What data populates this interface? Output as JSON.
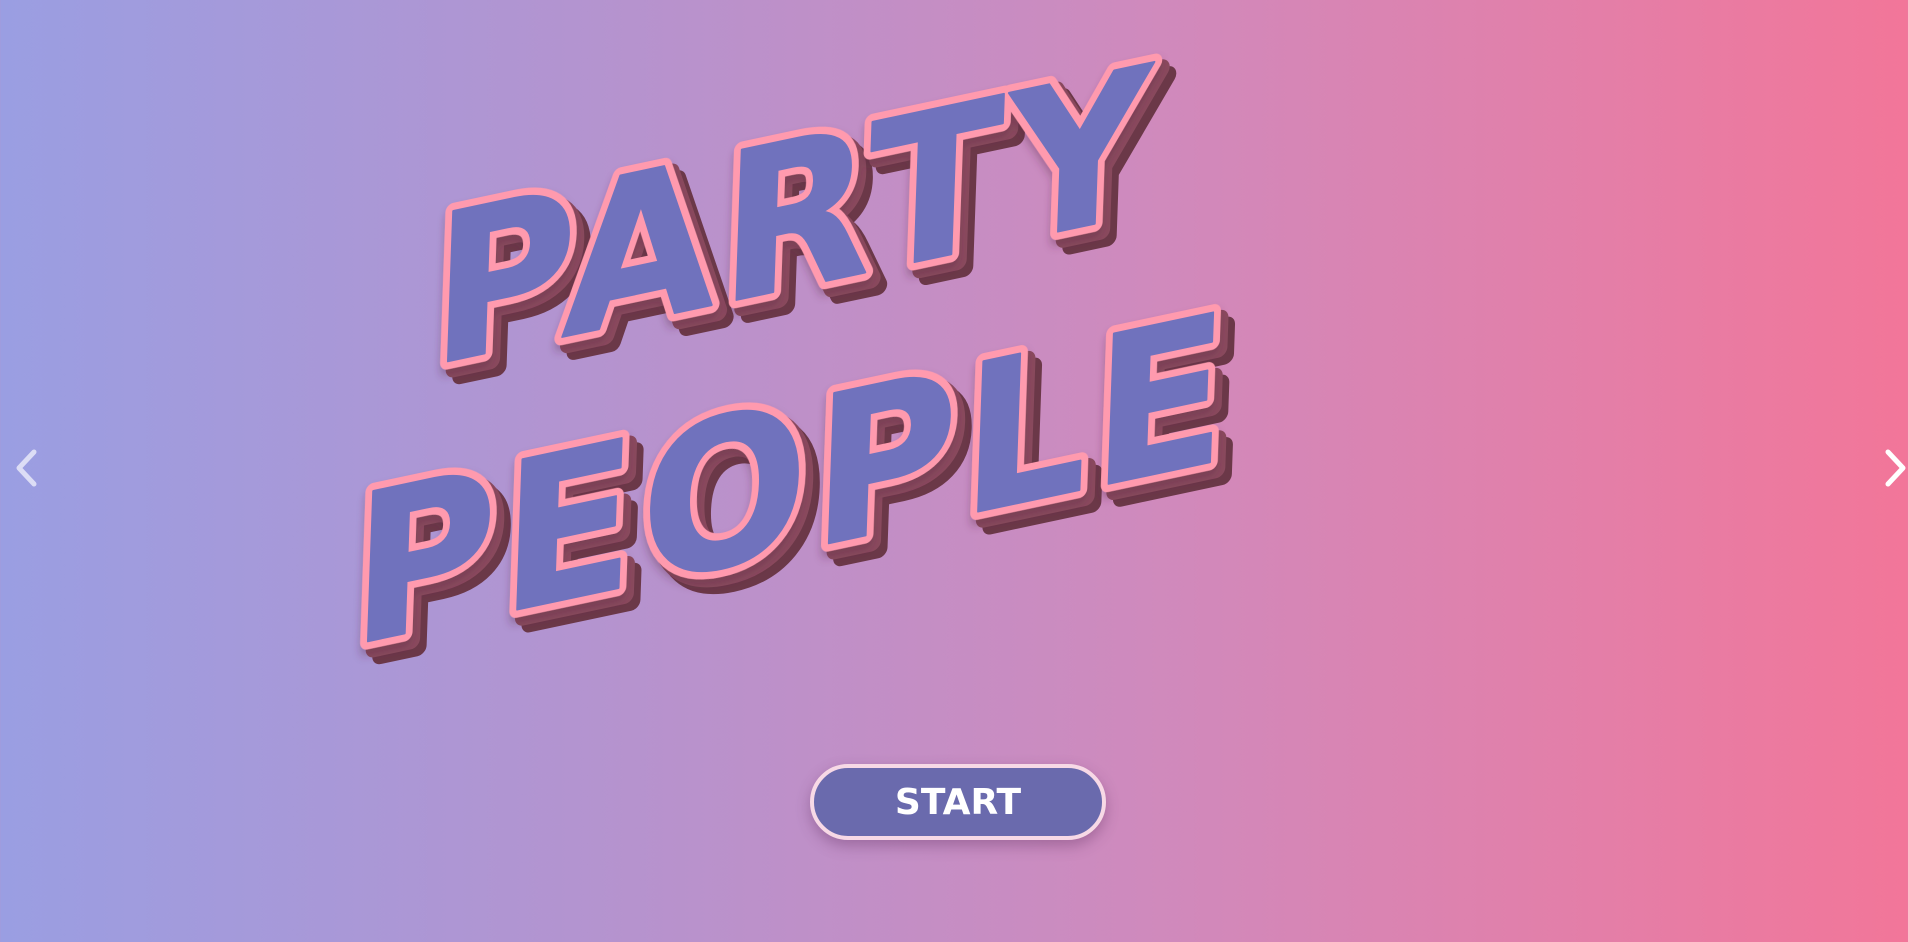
{
  "logo": {
    "line1": "PARTY",
    "line2": "PEOPLE"
  },
  "start_button": {
    "label": "START"
  },
  "nav": {
    "prev_icon": "chevron-left-icon",
    "next_icon": "chevron-right-icon"
  },
  "colors": {
    "background_left": "#9a9ee2",
    "background_right": "#f27699",
    "logo_fill": "#7072bd",
    "logo_outline": "#ff9aae",
    "logo_extrude": "#6b3848",
    "button_fill": "#6a6aad",
    "button_border": "#f7d9e6",
    "arrow": "#ffffff"
  }
}
